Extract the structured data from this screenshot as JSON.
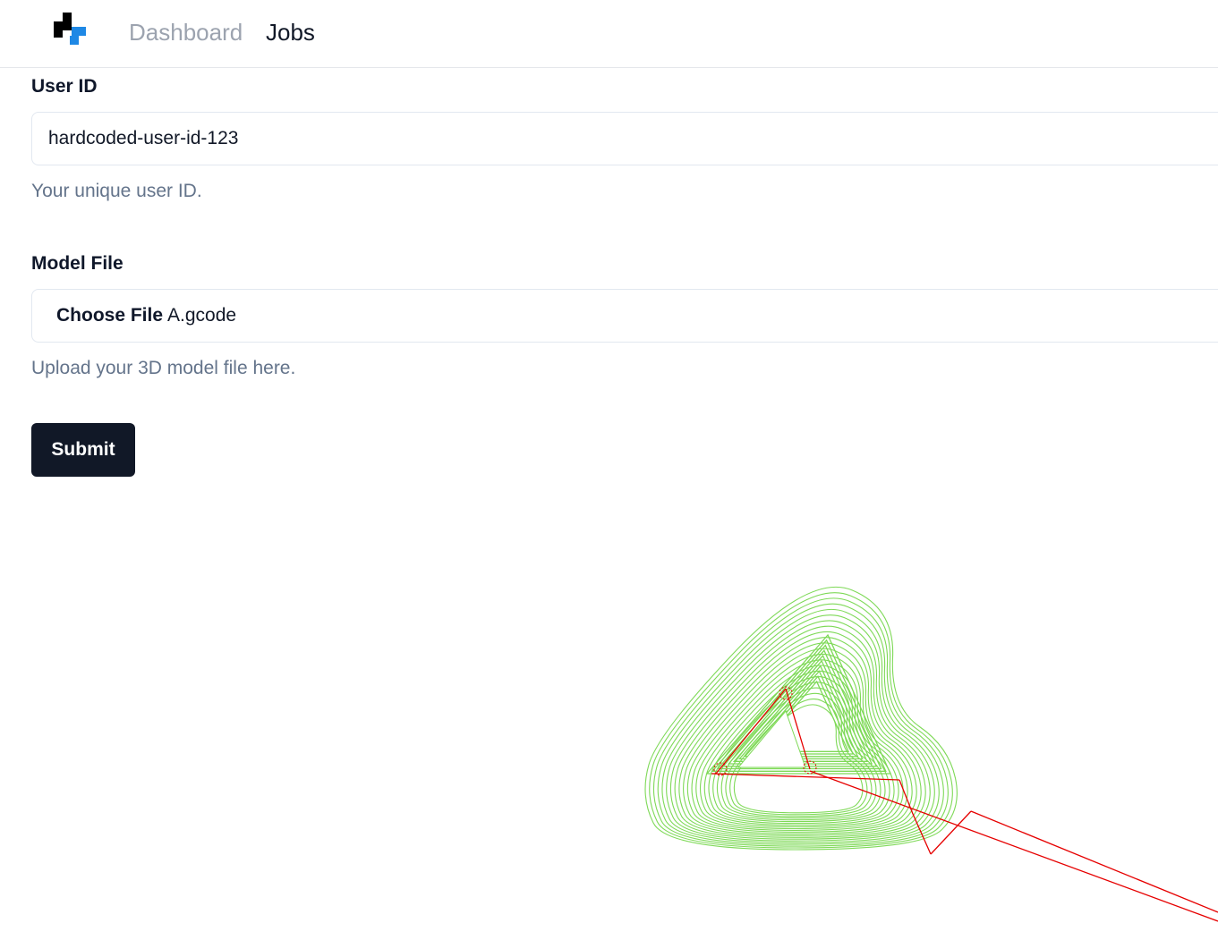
{
  "nav": {
    "links": [
      {
        "label": "Dashboard"
      },
      {
        "label": "Jobs"
      }
    ],
    "logo_colors": {
      "dark": "#000000",
      "accent": "#1e88e5"
    }
  },
  "form": {
    "user_id": {
      "label": "User ID",
      "value": "hardcoded-user-id-123",
      "help": "Your unique user ID."
    },
    "model_file": {
      "label": "Model File",
      "button_label": "Choose File",
      "file_name": "A.gcode",
      "help": "Upload your 3D model file here."
    },
    "submit_label": "Submit"
  },
  "viewer": {
    "content": "gcode toolpath preview",
    "extrusion_color": "#7ed957",
    "travel_color": "#e60000"
  }
}
